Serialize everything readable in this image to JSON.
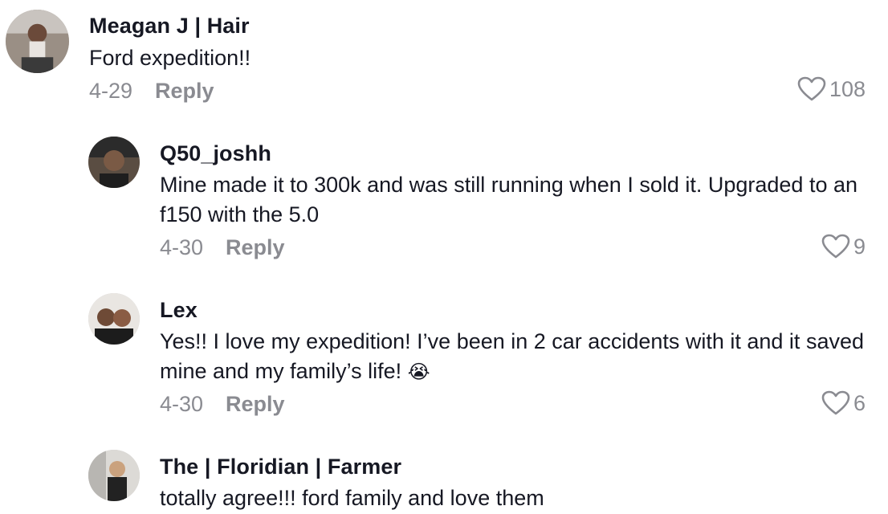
{
  "comments": [
    {
      "username": "Meagan J | Hair",
      "text": "Ford expedition!!",
      "date": "4-29",
      "reply_label": "Reply",
      "likes": "108",
      "avatar_icon": "user-photo"
    },
    {
      "username": "Q50_joshh",
      "text": "Mine made it to 300k and was still running when I sold it. Upgraded to an f150 with the 5.0",
      "date": "4-30",
      "reply_label": "Reply",
      "likes": "9",
      "avatar_icon": "user-photo"
    },
    {
      "username": "Lex",
      "text": "Yes!! I love my expedition! I’ve been in 2 car accidents with it and it saved mine and my family’s life!",
      "emoji": "😭",
      "date": "4-30",
      "reply_label": "Reply",
      "likes": "6",
      "avatar_icon": "user-photo"
    },
    {
      "username": "The | Floridian | Farmer",
      "text": "totally agree!!! ford family and love them",
      "avatar_icon": "user-photo"
    }
  ],
  "icons": {
    "like": "heart-outline-icon"
  },
  "colors": {
    "text": "#161823",
    "muted": "#8a8b91",
    "background": "#ffffff"
  }
}
